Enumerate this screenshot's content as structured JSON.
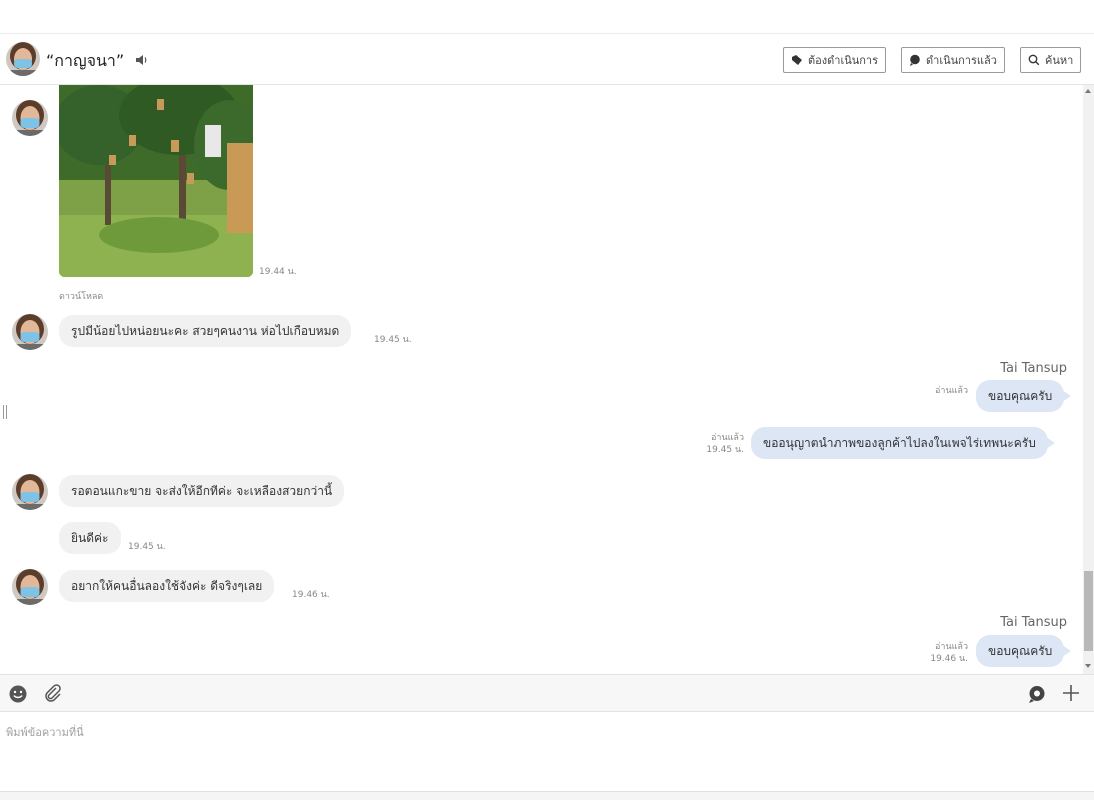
{
  "header": {
    "contact_name": "“กาญจนา”",
    "buttons": {
      "pending": "ต้องดำเนินการ",
      "done": "ดำเนินการแล้ว",
      "search": "ค้นหา"
    }
  },
  "messages": {
    "photo_time": "19.44 น.",
    "download_label": "ดาวน์โหลด",
    "m1_text": "รูปมีน้อยไปหน่อยนะคะ สวยๆคนงาน ห่อไปเกือบหมด",
    "m1_time": "19.45 น.",
    "sender_1": "Tai Tansup",
    "o1_read": "อ่านแล้ว",
    "o1_text": "ขอบคุณครับ",
    "o2_read": "อ่านแล้ว",
    "o2_time": "19.45 น.",
    "o2_text": "ขออนุญาตนำภาพของลูกค้าไปลงในเพจไร่เทพนะครับ",
    "m2_text": "รอตอนแกะขาย จะส่งให้อีกทีค่ะ จะเหลืองสวยกว่านี้",
    "m3_text": "ยินดีค่ะ",
    "m3_time": "19.45 น.",
    "m4_text": "อยากให้คนอื่นลองใช้จังค่ะ ดีจริงๆเลย",
    "m4_time": "19.46 น.",
    "sender_2": "Tai Tansup",
    "o3_read": "อ่านแล้ว",
    "o3_time": "19.46 น.",
    "o3_text": "ขอบคุณครับ"
  },
  "composer": {
    "placeholder": "พิมพ์ข้อความที่นี่",
    "value": ""
  },
  "icons": {
    "speaker": "speaker-icon",
    "emoji": "emoji-icon",
    "attach": "paperclip-icon",
    "chat": "chat-bubble-icon",
    "add": "plus-icon",
    "search": "search-icon"
  },
  "colors": {
    "outgoing_bubble": "#dce6f5",
    "incoming_bubble": "#f1f1f1"
  }
}
